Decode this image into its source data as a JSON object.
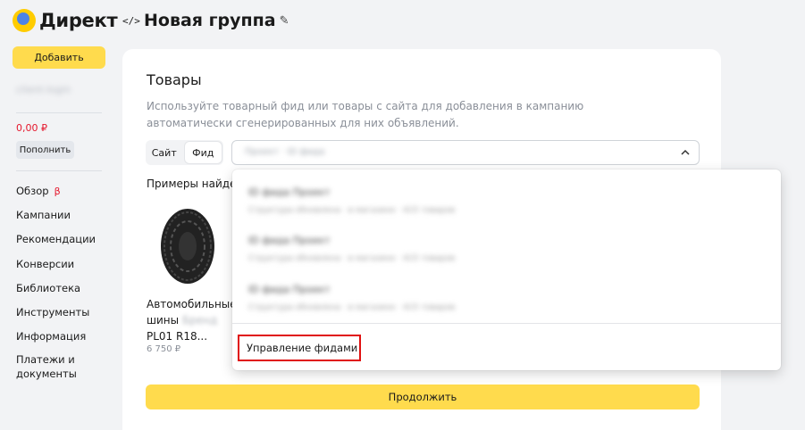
{
  "sidebar": {
    "logo_text": "Директ",
    "add_button": "Добавить",
    "account_name": "client-login",
    "balance": "0,00 ₽",
    "topup_button": "Пополнить",
    "nav": [
      {
        "label": "Обзор",
        "badge": "β"
      },
      {
        "label": "Кампании"
      },
      {
        "label": "Рекомендации"
      },
      {
        "label": "Конверсии"
      },
      {
        "label": "Библиотека"
      },
      {
        "label": "Инструменты"
      },
      {
        "label": "Информация"
      },
      {
        "label_line1": "Платежи и",
        "label_line2": "документы"
      }
    ]
  },
  "header": {
    "code_icon": "</>",
    "title": "Новая группа",
    "edit_icon": "✎"
  },
  "card": {
    "title": "Товары",
    "description": "Используйте товарный фид или товары с сайта для добавления в кампанию автоматически сгенерированных для них объявлений.",
    "segment": {
      "site": "Сайт",
      "feed": "Фид",
      "selected": "Фид"
    },
    "select_value": "Проект · ID фида",
    "examples_title": "Примеры найде",
    "product": {
      "name_prefix": "Автомобильные шины",
      "name_blurred": "Бренд",
      "name_suffix": "PL01 R18...",
      "price": "6 750 ₽"
    },
    "continue_button": "Продолжить"
  },
  "dropdown": {
    "items": [
      {
        "name": "ID фида Проект",
        "meta": "Структура обновлена · в магазине · 415 товаров"
      },
      {
        "name": "ID фида Проект",
        "meta": "Структура обновлена · в магазине · 415 товаров"
      },
      {
        "name": "ID фида Проект",
        "meta": "Структура обновлена · в магазине · 415 товаров"
      }
    ],
    "manage_link": "Управление фидами"
  },
  "colors": {
    "accent_yellow": "#ffdb4d",
    "balance_red": "#e5172c",
    "highlight_red": "#e01010",
    "page_bg": "#f2f3f5"
  }
}
